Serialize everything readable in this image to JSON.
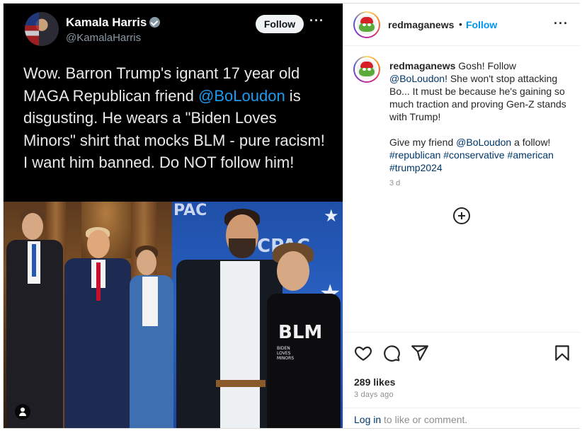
{
  "tweet": {
    "name": "Kamala Harris",
    "handle": "@KamalaHarris",
    "follow_label": "Follow",
    "more_label": "···",
    "text_before": "Wow. Barron Trump's ignant 17 year old MAGA Republican friend ",
    "mention": "@BoLoudon",
    "text_after": " is disgusting. He wears a \"Biden Loves Minors\" shirt that mocks BLM - pure racism! I want him banned. Do NOT follow him!"
  },
  "photo": {
    "banner_1": "PAC",
    "banner_2": "CPAC",
    "shirt_text": "BLM",
    "shirt_sub": "BIDEN LOVES MINORS"
  },
  "post": {
    "username": "redmaganews",
    "separator": "•",
    "follow_label": "Follow",
    "more_label": "···",
    "caption_user": "redmaganews",
    "caption_p1_a": " Gosh! Follow ",
    "caption_p1_mention": "@BoLoudon",
    "caption_p1_b": "! She won't stop attacking Bo... It must be because he's gaining so much traction and proving Gen-Z stands with Trump!",
    "caption_p2_a": "Give my friend ",
    "caption_p2_mention": "@BoLoudon",
    "caption_p2_b": " a follow!",
    "hashtags": "#republican #conservative #american #trump2024",
    "caption_time": "3 d",
    "likes": "289 likes",
    "posted": "3 days ago",
    "login_link": "Log in",
    "login_rest": " to like or comment."
  },
  "colors": {
    "accent": "#0095f6",
    "mention_twitter": "#1d9bf0",
    "link": "#00376b"
  },
  "icons": [
    "verified-badge-icon",
    "user-tag-icon",
    "add-comment-icon",
    "heart-icon",
    "comment-icon",
    "share-icon",
    "bookmark-icon"
  ]
}
